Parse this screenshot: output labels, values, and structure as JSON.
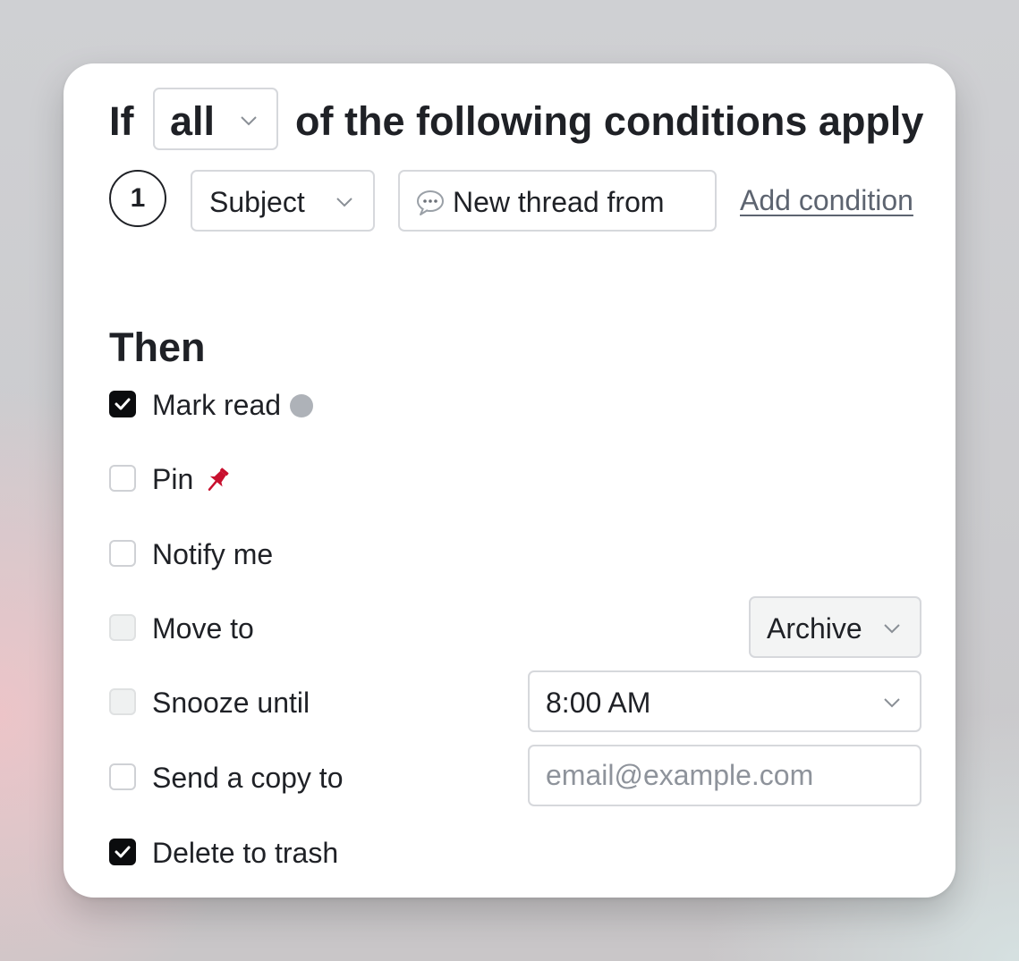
{
  "header": {
    "prefix": "If",
    "match_select": {
      "value": "all"
    },
    "suffix": "of the following conditions apply"
  },
  "condition": {
    "step_number": "1",
    "field_select": {
      "value": "Subject"
    },
    "value_text": "New thread from",
    "value_icon": "speech-bubble-icon",
    "add_link": "Add condition"
  },
  "then": {
    "heading": "Then",
    "actions": [
      {
        "label": "Mark read",
        "checked": true,
        "icon": "gray-dot-icon"
      },
      {
        "label": "Pin",
        "checked": false,
        "icon": "pushpin-icon"
      },
      {
        "label": "Notify me",
        "checked": false
      },
      {
        "label": "Move to",
        "checked": false,
        "disabled": true,
        "control_value": "Archive"
      },
      {
        "label": "Snooze until",
        "checked": false,
        "disabled": true,
        "control_value": "8:00 AM"
      },
      {
        "label": "Send a copy to",
        "checked": false,
        "control_placeholder": "email@example.com"
      },
      {
        "label": "Delete to trash",
        "checked": true
      }
    ]
  },
  "colors": {
    "text": "#1f2126",
    "border": "#d6d8dc",
    "link": "#5d6470",
    "checked": "#0b0c0e",
    "pin": "#c8102e",
    "dot": "#aeb2b8"
  }
}
